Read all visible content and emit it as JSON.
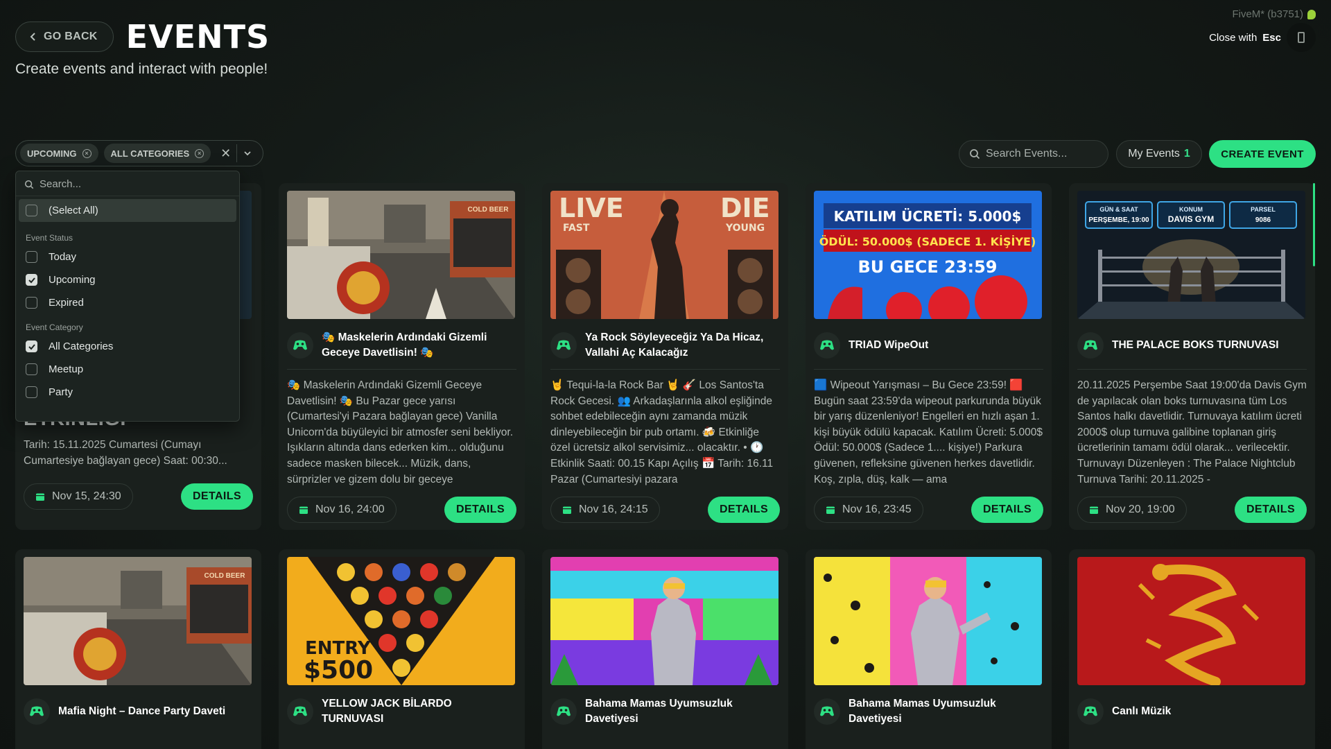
{
  "header": {
    "back_label": "GO BACK",
    "title": "EVENTS",
    "subtitle": "Create events and interact with people!",
    "build": "FiveM* (b3751)",
    "close_prefix": "Close with",
    "close_key": "Esc"
  },
  "filters": {
    "chip_status": "UPCOMING",
    "chip_category": "ALL CATEGORIES",
    "search_placeholder": "Search Events...",
    "my_events_label": "My Events",
    "my_events_count": "1",
    "create_label": "CREATE EVENT"
  },
  "dropdown": {
    "search_placeholder": "Search...",
    "select_all": "(Select All)",
    "group_status": "Event Status",
    "status_today": "Today",
    "status_upcoming": "Upcoming",
    "status_expired": "Expired",
    "group_category": "Event Category",
    "cat_all": "All Categories",
    "cat_meetup": "Meetup",
    "cat_party": "Party"
  },
  "cards": [
    {
      "title_partial": "ETKİNLİĞİ",
      "desc": "Tarih: 15.11.2025 Cumartesi (Cumayı Cumartesiye bağlayan gece) Saat: 00:30...",
      "date": "Nov 15, 24:30",
      "details": "DETAILS"
    },
    {
      "title": "🎭 Maskelerin Ardındaki Gizemli Geceye Davetlisin! 🎭",
      "desc": "🎭 Maskelerin Ardındaki Gizemli Geceye Davetlisin! 🎭 Bu Pazar gece yarısı (Cumartesi'yi Pazara bağlayan gece) Vanilla Unicorn'da büyüleyici bir atmosfer seni bekliyor. Işıkların altında dans ederken kim... olduğunu sadece masken bilecek... Müzik, dans, sürprizler ve gizem dolu bir geceye",
      "date": "Nov 16, 24:00",
      "details": "DETAILS"
    },
    {
      "title": "Ya Rock Söyleyeceğiz Ya Da Hicaz, Vallahi Aç Kalacağız",
      "desc": "🤘 Tequi-la-la Rock Bar 🤘 🎸 Los Santos'ta Rock Gecesi. 👥 Arkadaşlarınla alkol eşliğinde sohbet edebileceğin aynı zamanda müzik dinleyebileceğin bir pub ortamı. 🍻 Etkinliğe özel ücretsiz alkol servisimiz... olacaktır. • 🕐 Etkinlik Saati: 00.15 Kapı Açılış 📅 Tarih: 16.11 Pazar (Cumartesiyi pazara",
      "date": "Nov 16, 24:15",
      "details": "DETAILS"
    },
    {
      "title": "TRIAD WipeOut",
      "desc": "🟦 Wipeout Yarışması – Bu Gece 23:59! 🟥 Bugün saat 23:59'da wipeout parkurunda büyük bir yarış düzenleniyor! Engelleri en hızlı aşan 1. kişi büyük ödülü kapacak. Katılım Ücreti: 5.000$ Ödül: 50.000$ (Sadece 1.... kişiye!) Parkura güvenen, refleksine güvenen herkes davetlidir. Koş, zıpla, düş, kalk — ama",
      "date": "Nov 16, 23:45",
      "details": "DETAILS"
    },
    {
      "title": "THE PALACE BOKS TURNUVASI",
      "desc": "20.11.2025 Perşembe Saat 19:00'da Davis Gym de yapılacak olan boks turnuvasına tüm Los Santos halkı davetlidir. Turnuvaya katılım ücreti 2000$ olup turnuva galibine toplanan giriş ücretlerinin tamamı ödül olarak... verilecektir. Turnuvayı Düzenleyen : The Palace Nightclub Turnuva Tarihi: 20.11.2025 -",
      "date": "Nov 20, 19:00",
      "details": "DETAILS"
    },
    {
      "title": "Mafia Night – Dance Party Daveti"
    },
    {
      "title": "YELLOW JACK BİLARDO TURNUVASI"
    },
    {
      "title": "Bahama Mamas Uyumsuzluk Davetiyesi"
    },
    {
      "title": "Bahama Mamas Uyumsuzluk Davetiyesi"
    },
    {
      "title": "Canlı Müzik"
    }
  ],
  "posters": {
    "rock_left": "LIVE",
    "rock_left_sub": "FAST",
    "rock_right": "DIE",
    "rock_right_sub": "YOUNG",
    "wipe_fee": "KATILIM ÜCRETİ: 5.000$",
    "wipe_prize": "ÖDÜL: 50.000$ (SADECE 1. KİŞİYE)",
    "wipe_time": "BU GECE 23:59",
    "box_t1": "GÜN & SAAT",
    "box_v1": "PERŞEMBE, 19:00",
    "box_t2": "KONUM",
    "box_v2": "DAVIS GYM",
    "box_t3": "PARSEL",
    "box_v3": "9086",
    "pool_entry": "ENTRY",
    "pool_amount": "$500",
    "cold_beer": "COLD BEER"
  },
  "colors": {
    "accent": "#2de084",
    "bg": "#141a17",
    "card": "#1a201d"
  }
}
